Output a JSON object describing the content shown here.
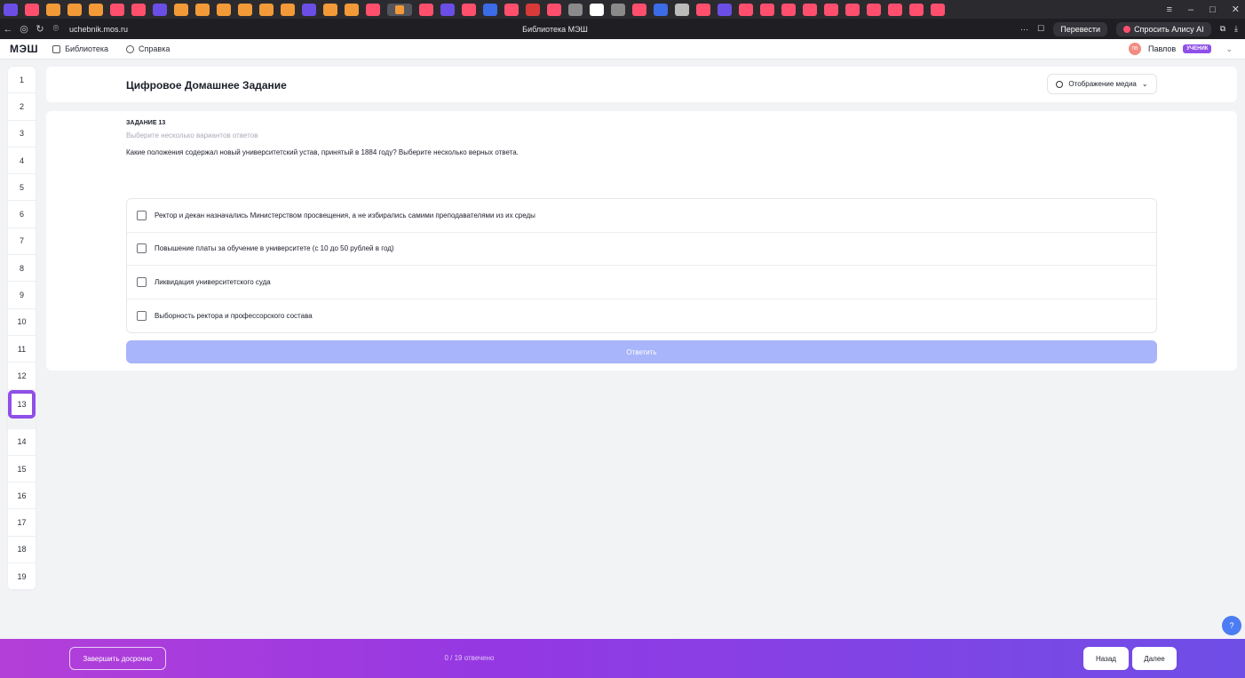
{
  "browser": {
    "url": "uchebnik.mos.ru",
    "page_title": "Библиотека МЭШ",
    "translate_label": "Перевести",
    "alice_label": "Спросить Алису AI",
    "tab_colors": [
      "#6b4ee6",
      "#ff4f6d",
      "#f39a38",
      "#f39a38",
      "#f39a38",
      "#ff4f6d",
      "#ff4f6d",
      "#6b4ee6",
      "#f39a38",
      "#f39a38",
      "#f39a38",
      "#f39a38",
      "#f39a38",
      "#f39a38",
      "#6b4ee6",
      "#f39a38",
      "#f39a38",
      "#ff4f6d",
      "#ff4f6d",
      "#ff4f6d",
      "#6b4ee6",
      "#ff4f6d",
      "#3c6be8",
      "#ff4f6d",
      "#d83a3a",
      "#ff4f6d",
      "#8a8a8a",
      "#ffffff",
      "#8a8a8a",
      "#ff4f6d",
      "#3c6be8",
      "#bbbbbb",
      "#ff4f6d",
      "#6b4ee6",
      "#ff4f6d",
      "#ff4f6d",
      "#ff4f6d",
      "#ff4f6d",
      "#ff4f6d",
      "#ff4f6d",
      "#ff4f6d",
      "#ff4f6d",
      "#ff4f6d",
      "#ff4f6d"
    ]
  },
  "header": {
    "logo": "МЭШ",
    "library_label": "Библиотека",
    "help_label": "Справка",
    "user_initials": "ПВ",
    "user_name": "Павлов",
    "role_badge": "УЧЕНИК"
  },
  "nav": {
    "items_top": [
      "1",
      "2",
      "3",
      "4",
      "5",
      "6",
      "7",
      "8",
      "9",
      "10",
      "11",
      "12"
    ],
    "active": "13",
    "items_bottom": [
      "14",
      "15",
      "16",
      "17",
      "18",
      "19"
    ]
  },
  "assignment": {
    "title": "Цифровое Домашнее Задание",
    "media_label": "Отображение медиа",
    "task_number": "ЗАДАНИЕ 13",
    "hint": "Выберите несколько вариантов ответов",
    "question": "Какие положения содержал новый университетский устав, принятый в 1884 году? Выберите несколько верных ответа.",
    "answers": [
      "Ректор и декан назначались Министерством просвещения, а не избирались самими преподавателями из их среды",
      "Повышение платы за обучение в университете (с 10 до 50 рублей в год)",
      "Ликвидация университетского суда",
      "Выборность ректора и профессорского состава"
    ],
    "submit_label": "Ответить"
  },
  "footer": {
    "finish_label": "Завершить досрочно",
    "progress": "0 / 19 отвечено",
    "back_label": "Назад",
    "next_label": "Далее"
  },
  "help_fab": "?"
}
